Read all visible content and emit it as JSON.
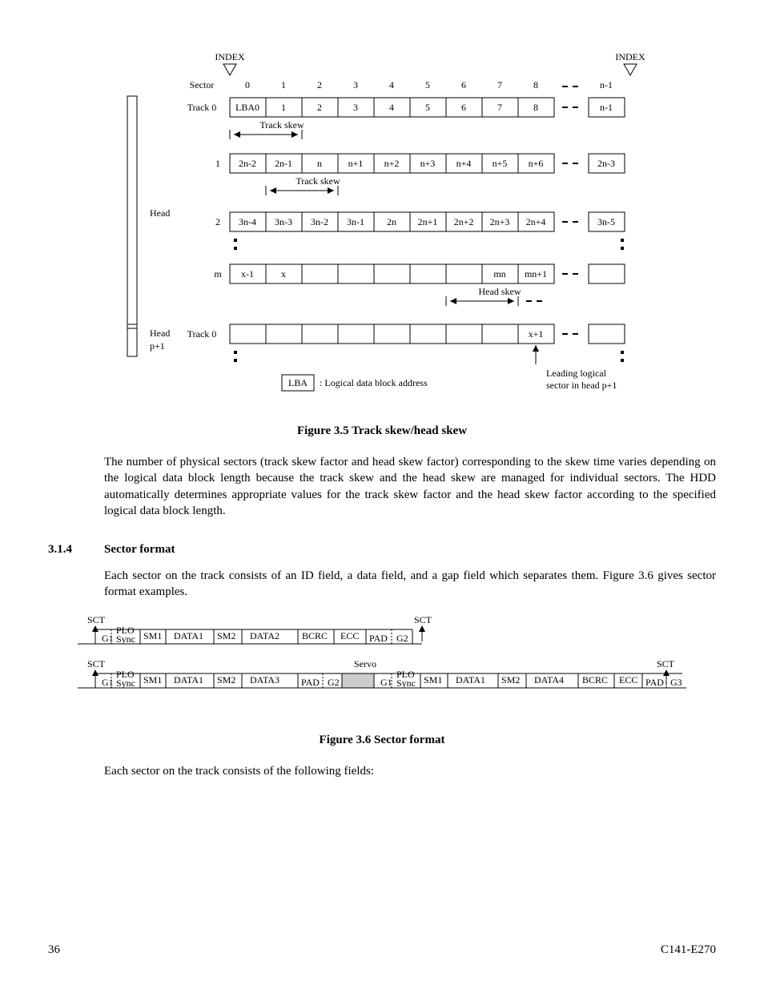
{
  "figure35": {
    "caption": "Figure 3.5    Track skew/head skew",
    "indexLabel": "INDEX",
    "sectorLabel": "Sector",
    "headLabel": "Head",
    "headP1Label": "Head p+1",
    "trackSkewLabel": "Track skew",
    "headSkewLabel": "Head skew",
    "lbaLabel": "LBA",
    "lbaDesc": ": Logical data block address",
    "leadingLogical1": "Leading logical",
    "leadingLogical2": "sector in head p+1",
    "sectorRow": [
      "0",
      "1",
      "2",
      "3",
      "4",
      "5",
      "6",
      "7",
      "8",
      "n-1"
    ],
    "track0Label": "Track 0",
    "track0Row": [
      "LBA0",
      "1",
      "2",
      "3",
      "4",
      "5",
      "6",
      "7",
      "8",
      "n-1"
    ],
    "track1Label": "1",
    "track1Row": [
      "2n-2",
      "2n-1",
      "n",
      "n+1",
      "n+2",
      "n+3",
      "n+4",
      "n+5",
      "n+6",
      "2n-3"
    ],
    "track2Label": "2",
    "track2Row": [
      "3n-4",
      "3n-3",
      "3n-2",
      "3n-1",
      "2n",
      "2n+1",
      "2n+2",
      "2n+3",
      "2n+4",
      "3n-5"
    ],
    "trackMLabel": "m",
    "trackMRow": [
      "x-1",
      "x",
      "",
      "",
      "",
      "",
      "",
      "mn",
      "mn+1",
      ""
    ],
    "headP1Track0Label": "Track 0",
    "headP1Row": [
      "",
      "",
      "",
      "",
      "",
      "",
      "",
      "",
      "x+1",
      ""
    ]
  },
  "para1": "The number of physical sectors (track skew factor and head skew factor) corresponding to the skew time varies depending on the logical data block length because the track skew and the head skew are managed for individual sectors.  The HDD automatically determines appropriate values for the track skew factor and the head skew factor according to the specified logical data block length.",
  "section": {
    "number": "3.1.4",
    "title": "Sector format"
  },
  "para2": "Each sector on the track consists of an ID field, a data field, and a gap field which separates them.  Figure 3.6 gives sector format examples.",
  "figure36": {
    "caption": "Figure 3.6    Sector format",
    "sctLabel": "SCT",
    "servoLabel": "Servo",
    "row1": [
      "G1",
      "PLO Sync",
      "SM1",
      "DATA1",
      "SM2",
      "DATA2",
      "BCRC",
      "ECC",
      "PAD",
      "G2"
    ],
    "row2a": [
      "G1",
      "PLO Sync",
      "SM1",
      "DATA1",
      "SM2",
      "DATA3",
      "PAD",
      "G2"
    ],
    "row2b": [
      "G1",
      "PLO Sync",
      "SM1",
      "DATA1",
      "SM2",
      "DATA4",
      "BCRC",
      "ECC",
      "PAD",
      "G3"
    ]
  },
  "para3": "Each sector on the track consists of the following fields:",
  "footer": {
    "pageNumber": "36",
    "docId": "C141-E270"
  }
}
